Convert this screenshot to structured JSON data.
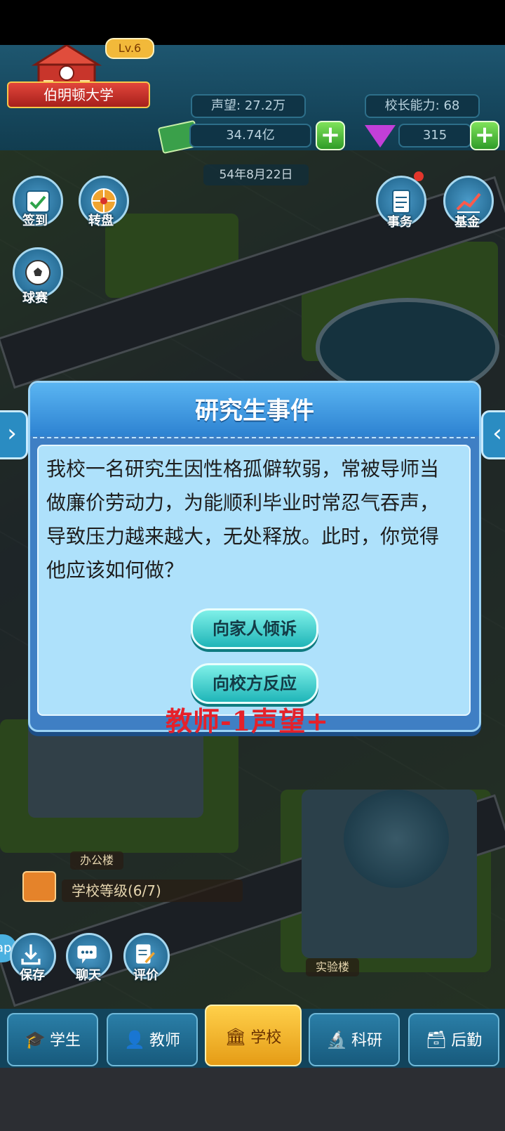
{
  "hud": {
    "school_name": "伯明顿大学",
    "level": "Lv.6",
    "reputation_label": "声望:",
    "reputation_value": "27.2万",
    "principal_label": "校长能力:",
    "principal_value": "68",
    "money": "34.74亿",
    "gems": "315",
    "date": "54年8月22日"
  },
  "left_icons": [
    {
      "label": "签到"
    },
    {
      "label": "转盘"
    },
    {
      "label": "球赛"
    }
  ],
  "right_icons": [
    {
      "label": "事务"
    },
    {
      "label": "基金"
    }
  ],
  "buildings": {
    "office": "办公楼",
    "lab": "实验楼",
    "school_level": "学校等级(6/7)"
  },
  "bottom_tools": [
    {
      "label": "保存"
    },
    {
      "label": "聊天"
    },
    {
      "label": "评价"
    }
  ],
  "side_tag": "ap",
  "tabs": [
    {
      "label": "学生"
    },
    {
      "label": "教师"
    },
    {
      "label": "学校"
    },
    {
      "label": "科研"
    },
    {
      "label": "后勤"
    }
  ],
  "dialog": {
    "title": "研究生事件",
    "text": "我校一名研究生因性格孤僻软弱，常被导师当做廉价劳动力，为能顺利毕业时常忍气吞声，导致压力越来越大，无处释放。此时，你觉得他应该如何做？",
    "option1": "向家人倾诉",
    "option2": "向校方反应",
    "handwritten_note": "教师-1声望+"
  },
  "colors": {
    "accent_blue": "#3f7fc4",
    "option_teal": "#1fb5b8",
    "active_tab": "#ffd04a",
    "note_red": "#e5212a"
  }
}
